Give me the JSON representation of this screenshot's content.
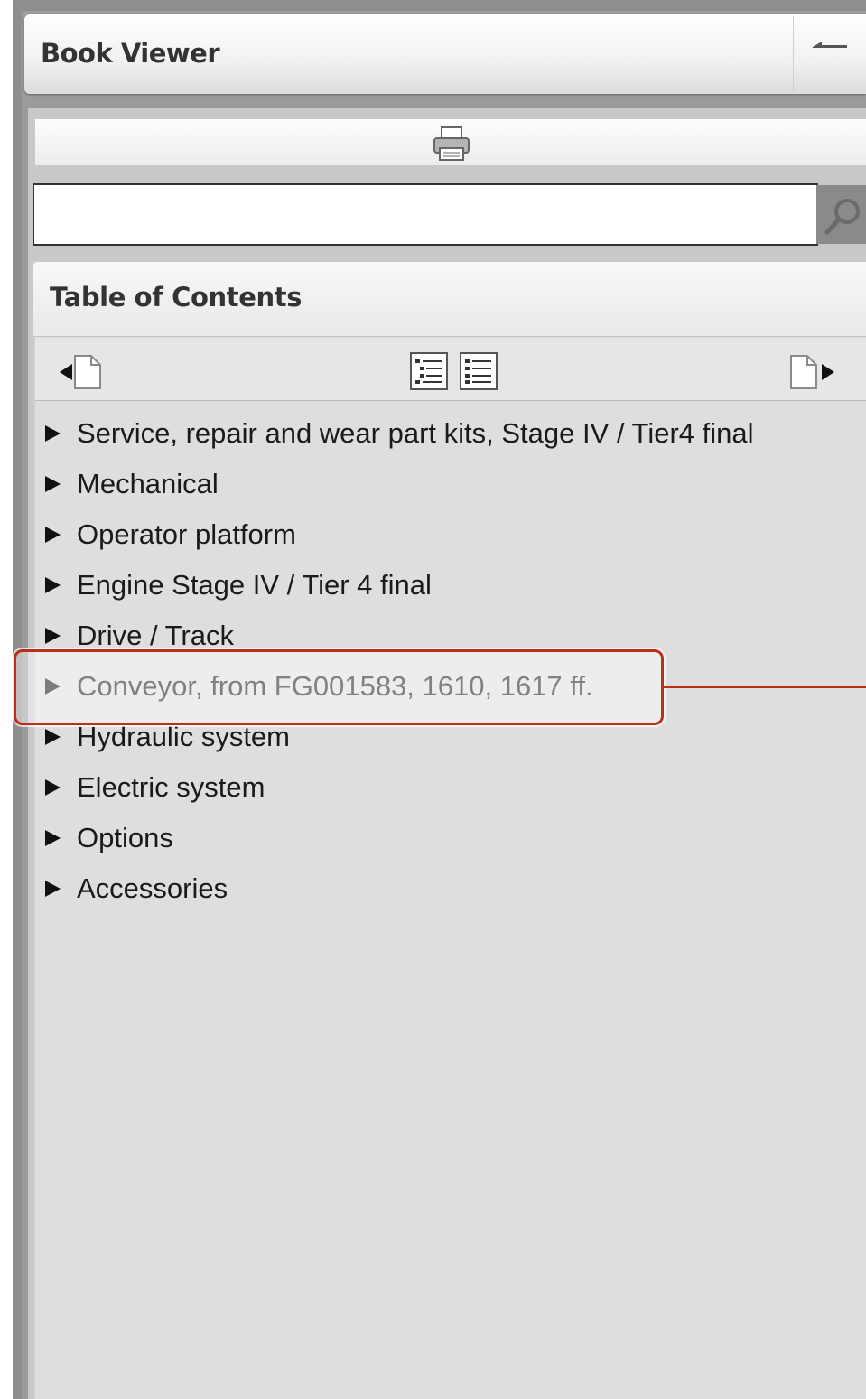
{
  "window": {
    "title": "Book Viewer",
    "minimize_icon": "minimize-icon"
  },
  "toolbar": {
    "print_icon": "printer-icon"
  },
  "search": {
    "value": "",
    "placeholder": "",
    "icon": "magnifier-icon"
  },
  "toc": {
    "title": "Table of Contents",
    "nav": {
      "prev_icon": "previous-page-icon",
      "collapse_icon": "collapse-all-icon",
      "expand_icon": "expand-all-icon",
      "next_icon": "next-page-icon"
    },
    "items": [
      {
        "label": "Service, repair and wear part kits, Stage IV / Tier4 final"
      },
      {
        "label": "Mechanical"
      },
      {
        "label": "Operator platform"
      },
      {
        "label": "Engine Stage IV / Tier 4 final"
      },
      {
        "label": "Drive / Track"
      },
      {
        "label": "Conveyor, from FG001583, 1610, 1617 ff."
      },
      {
        "label": "Hydraulic system"
      },
      {
        "label": "Electric system"
      },
      {
        "label": "Options"
      },
      {
        "label": "Accessories"
      }
    ],
    "highlighted_index": 5
  },
  "colors": {
    "callout": "#b9311b",
    "frame": "#8e8e8e",
    "toc_background": "#dedede"
  }
}
